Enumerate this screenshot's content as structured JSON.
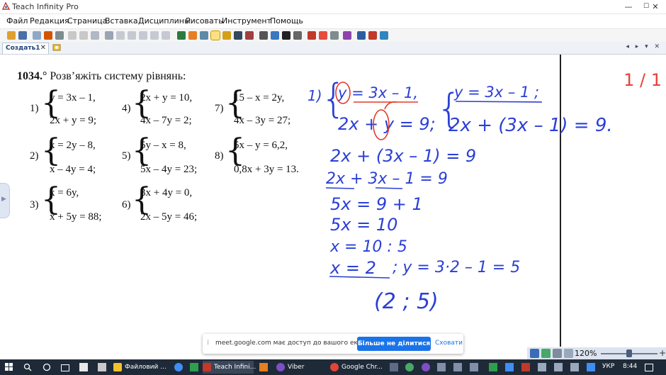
{
  "window": {
    "title": "Teach Infinity Pro",
    "min": "—",
    "max": "☐",
    "close": "✕"
  },
  "menu": [
    "Файл",
    "Редакция",
    "Страница",
    "Вставка",
    "Дисциплины",
    "Рисовать",
    "Инструмент",
    "Помощь"
  ],
  "tabs": {
    "active_label": "Создать1",
    "close": "✕",
    "nav": "◂ ▸ ▾ ✕"
  },
  "page_counter": "1  /  1",
  "textbook": {
    "number": "1034.°",
    "heading": "Розв’яжіть систему рівнянь:",
    "problems": [
      {
        "label": "1)",
        "eq1": "y = 3x – 1,",
        "eq2": "2x + y = 9;"
      },
      {
        "label": "2)",
        "eq1": "x = 2y – 8,",
        "eq2": "x – 4y = 4;"
      },
      {
        "label": "3)",
        "eq1": "x = 6y,",
        "eq2": "x + 5y = 88;"
      },
      {
        "label": "4)",
        "eq1": "2x + y = 10,",
        "eq2": "4x – 7y = 2;"
      },
      {
        "label": "5)",
        "eq1": "5y – x = 8,",
        "eq2": "5x – 4y = 23;"
      },
      {
        "label": "6)",
        "eq1": "3x + 4y = 0,",
        "eq2": "2x – 5y = 46;"
      },
      {
        "label": "7)",
        "eq1": "15 – x = 2y,",
        "eq2": "4x – 3y = 27;"
      },
      {
        "label": "8)",
        "eq1": "5x – y = 6,2,",
        "eq2": "0,8x + 3y = 13."
      }
    ]
  },
  "handwriting": {
    "lines": [
      "1)",
      "y = 3x – 1,",
      "2x + y = 9;",
      "y = 3x – 1 ;",
      "2x + (3x – 1) = 9.",
      "2x + (3x – 1) = 9",
      "2x + 3x – 1 = 9",
      "5x = 9 + 1",
      "5x = 10",
      "x = 10 : 5",
      "x = 2",
      "; y = 3·2 – 1 = 5",
      "(2 ; 5)"
    ],
    "ink_color": "#2b3fd6",
    "mark_color": "#e23a2a"
  },
  "share_bar": {
    "grip": "⁞",
    "message": "meet.google.com має доступ до вашого екрана.",
    "stop_button": "Більше не ділитися",
    "hide_button": "Сховати"
  },
  "zoom": {
    "value": "120%",
    "plus": "+",
    "level": 0.5
  },
  "taskbar": {
    "tasks": [
      {
        "label": "Файловий ..."
      },
      {
        "label": "Teach Infini..."
      },
      {
        "label": "Viber"
      },
      {
        "label": "Google Chr..."
      }
    ],
    "lang": "УКР",
    "time": "8:44"
  },
  "colors": {
    "accent": "#1a73e8",
    "counter": "#e8403a",
    "taskbar": "#1f2a38"
  }
}
